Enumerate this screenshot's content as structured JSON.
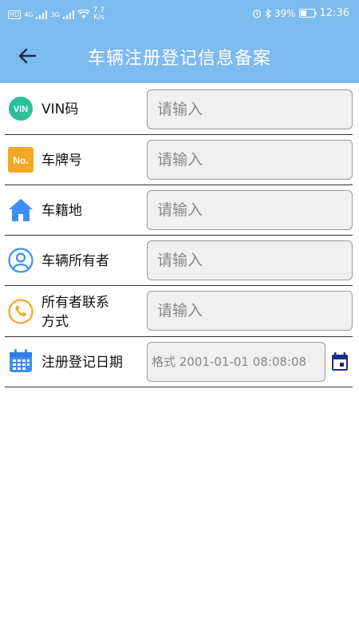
{
  "statusbar": {
    "left_badge": "HD",
    "signal1": "4G",
    "signal2": "3G",
    "speed": "7.7",
    "speed_unit": "K/s",
    "battery": "39%",
    "time": "12:36"
  },
  "header": {
    "title": "车辆注册登记信息备案"
  },
  "form": {
    "rows": [
      {
        "label": "VIN码",
        "icon_text": "VIN",
        "placeholder": "请输入"
      },
      {
        "label": "车牌号",
        "icon_text": "No.",
        "placeholder": "请输入"
      },
      {
        "label": "车籍地",
        "placeholder": "请输入"
      },
      {
        "label": "车辆所有者",
        "placeholder": "请输入"
      },
      {
        "label": "所有者联系方式",
        "label_line1": "所有者联系",
        "label_line2": "方式",
        "placeholder": "请输入"
      },
      {
        "label": "注册登记日期",
        "placeholder": "格式 2001-01-01 08:08:08"
      }
    ]
  },
  "colors": {
    "appbar": "#7dbaf0",
    "vin_icon": "#2bbf9b",
    "no_icon": "#f5a623",
    "home_icon": "#3d8ff5",
    "owner_icon": "#3d8ff5",
    "phone_icon": "#f5a623",
    "calendar_icon": "#3d8ff5",
    "calendar_button": "#1a2d8c"
  },
  "icons": {
    "back": "arrow-left-icon",
    "vin": "vin-icon",
    "plate": "number-icon",
    "home": "home-icon",
    "owner": "user-icon",
    "phone": "phone-icon",
    "calendar": "calendar-icon",
    "date_picker": "calendar-picker-icon"
  }
}
